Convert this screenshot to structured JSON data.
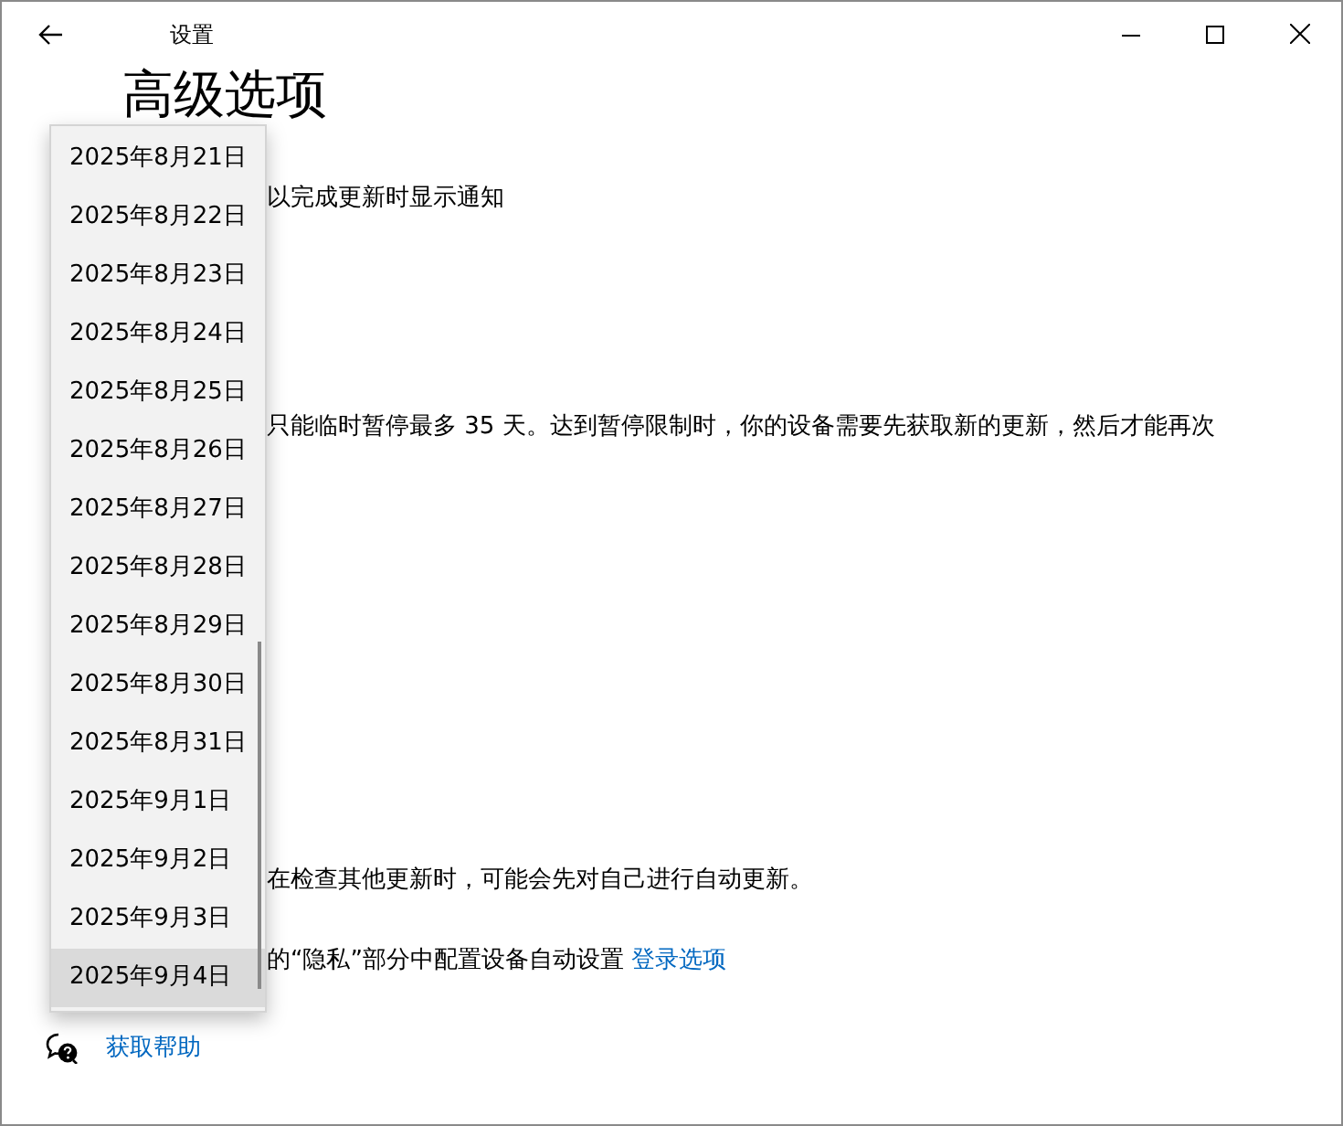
{
  "window": {
    "title": "设置"
  },
  "heading": "高级选项",
  "texts": [
    "以完成更新时显示通知",
    "只能临时暂停最多 35 天。达到暂停限制时，你的设备需要先获取新的更新，然后才能再次",
    "在检查其他更新时，可能会先对自己进行自动更新。"
  ],
  "privacy_line": {
    "text": "的“隐私”部分中配置设备自动设置",
    "link": "登录选项"
  },
  "date_dropdown": {
    "items": [
      {
        "label": "2025年8月21日",
        "selected": false
      },
      {
        "label": "2025年8月22日",
        "selected": false
      },
      {
        "label": "2025年8月23日",
        "selected": false
      },
      {
        "label": "2025年8月24日",
        "selected": false
      },
      {
        "label": "2025年8月25日",
        "selected": false
      },
      {
        "label": "2025年8月26日",
        "selected": false
      },
      {
        "label": "2025年8月27日",
        "selected": false
      },
      {
        "label": "2025年8月28日",
        "selected": false
      },
      {
        "label": "2025年8月29日",
        "selected": false
      },
      {
        "label": "2025年8月30日",
        "selected": false
      },
      {
        "label": "2025年8月31日",
        "selected": false
      },
      {
        "label": "2025年9月1日",
        "selected": false
      },
      {
        "label": "2025年9月2日",
        "selected": false
      },
      {
        "label": "2025年9月3日",
        "selected": false
      },
      {
        "label": "2025年9月4日",
        "selected": true
      }
    ]
  },
  "help_link": "获取帮助"
}
